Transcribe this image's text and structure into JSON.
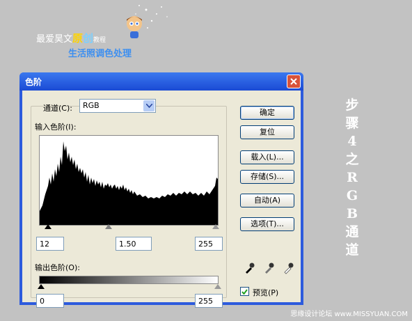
{
  "banner": {
    "brand_prefix": "最爱昊文",
    "brand_hl1": "原",
    "brand_hl2": "创",
    "brand_suffix": "教程",
    "subtitle": "生活照调色处理"
  },
  "side_text": [
    "步",
    "骤",
    "4",
    "之",
    "R",
    "G",
    "B",
    "通",
    "道"
  ],
  "credit": "思缘设计论坛 www.MISSYUAN.COM",
  "dialog": {
    "title": "色阶",
    "channel_label": "通道(C):",
    "channel_value": "RGB",
    "input_levels_label": "输入色阶(I):",
    "input_black": "12",
    "input_gamma": "1.50",
    "input_white": "255",
    "output_levels_label": "输出色阶(O):",
    "output_black": "0",
    "output_white": "255",
    "buttons": {
      "ok": "确定",
      "reset": "复位",
      "load": "载入(L)...",
      "save": "存储(S)...",
      "auto": "自动(A)",
      "options": "选项(T)..."
    },
    "preview_label": "预览(P)",
    "preview_checked": true
  },
  "colors": {
    "dialog_blue": "#2d5bdd",
    "client_bg": "#ece9d8",
    "background": "#c2c2c2",
    "subtitle_blue": "#3d8ff0"
  },
  "icons": [
    "close-icon",
    "chevron-down-icon",
    "black-eyedropper-icon",
    "gray-eyedropper-icon",
    "white-eyedropper-icon",
    "check-icon"
  ]
}
